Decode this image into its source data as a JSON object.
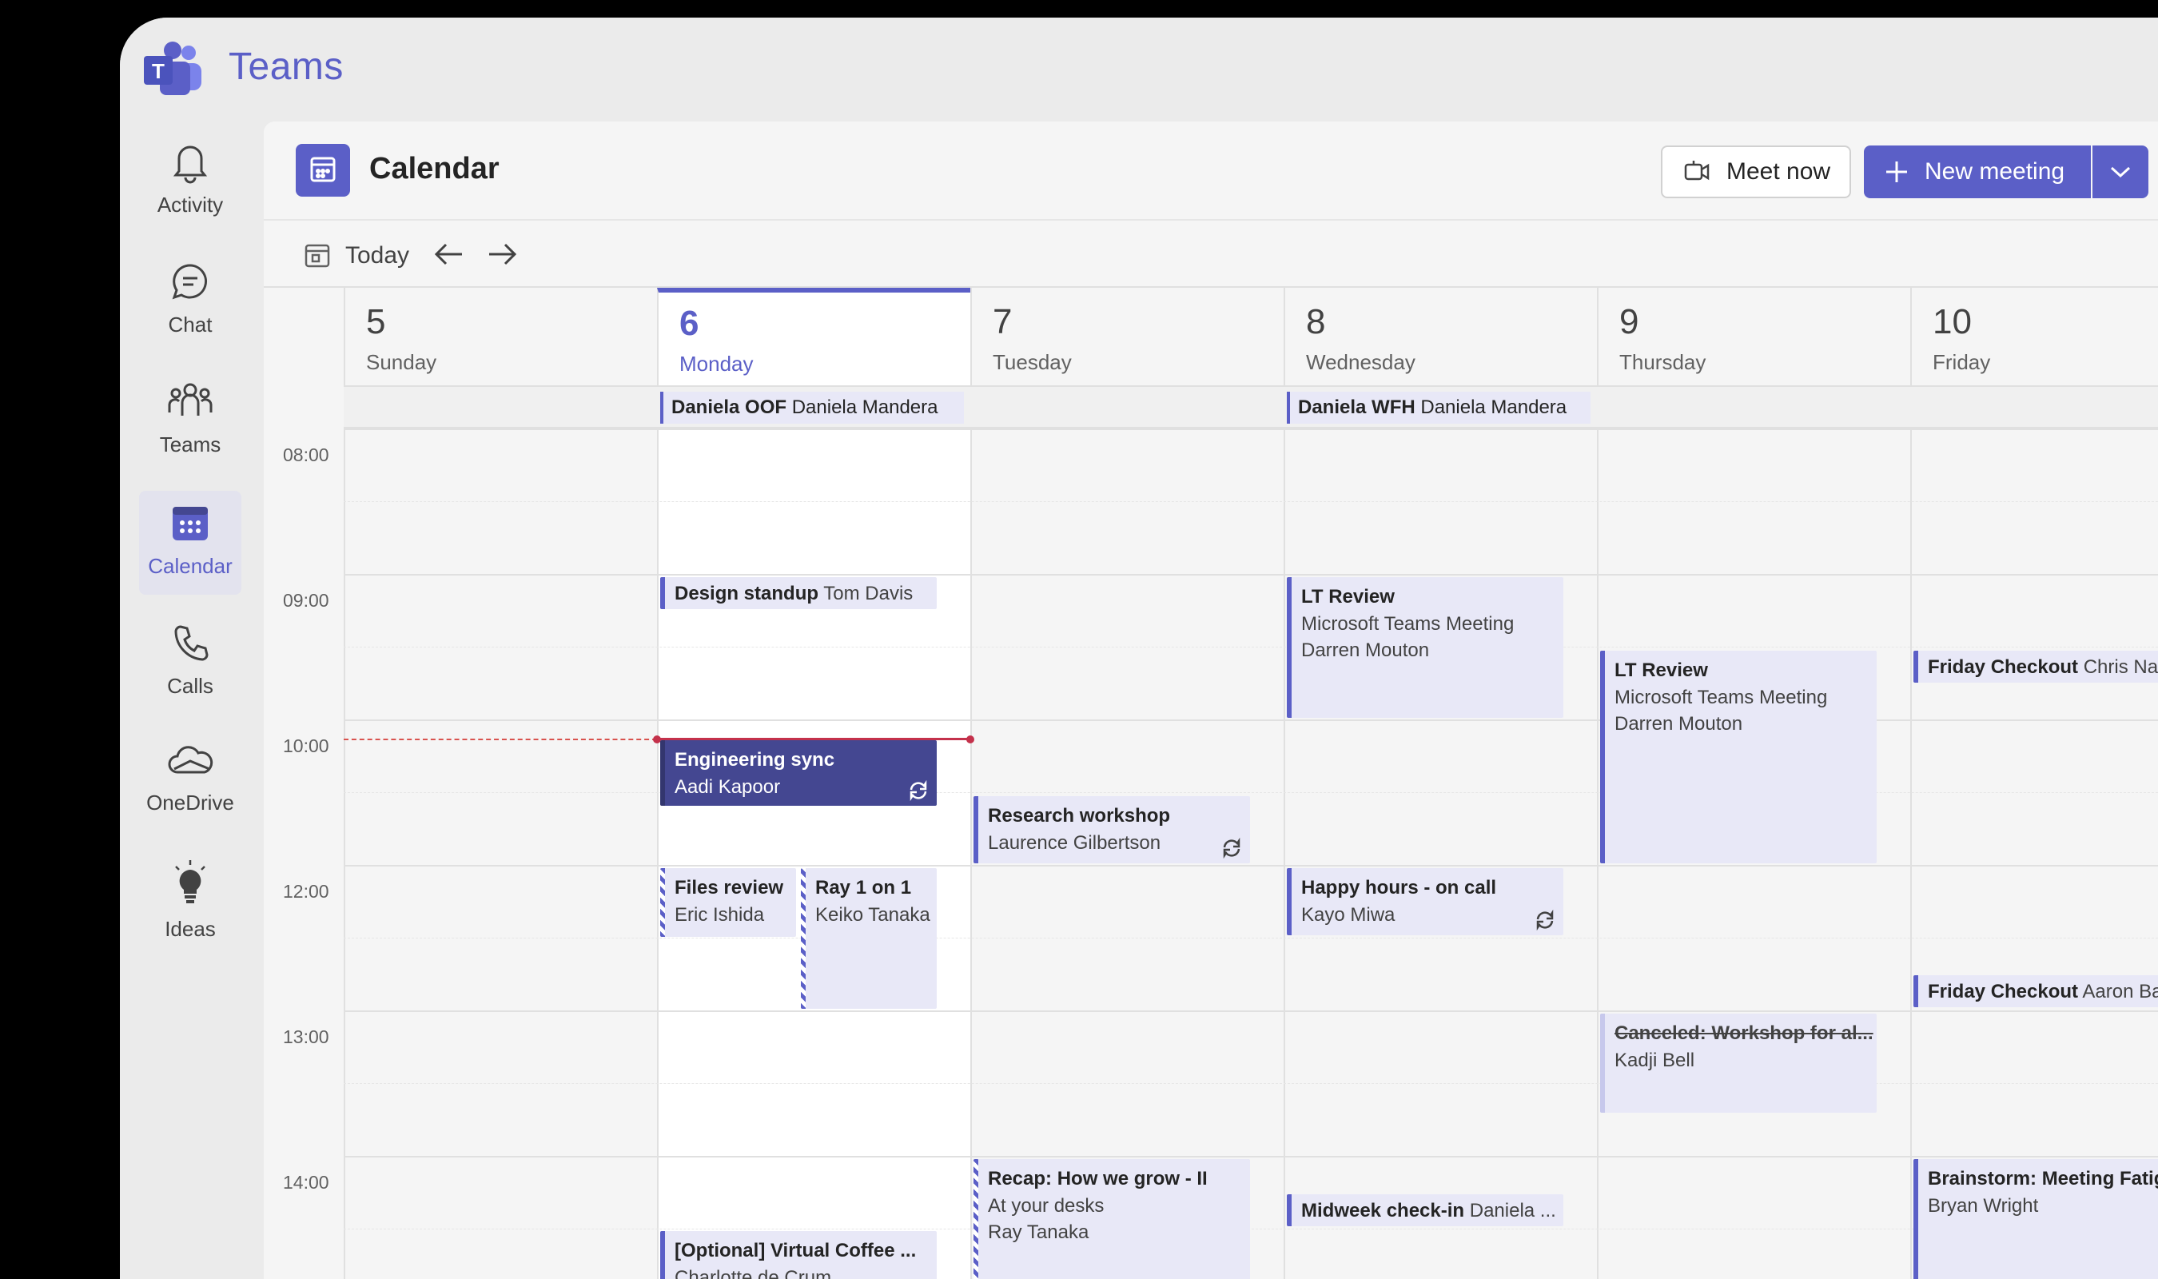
{
  "app": {
    "title": "Teams",
    "brand_color": "#5b5fc7"
  },
  "rail": [
    {
      "label": "Activity",
      "icon": "bell-icon"
    },
    {
      "label": "Chat",
      "icon": "chat-icon"
    },
    {
      "label": "Teams",
      "icon": "teams-icon"
    },
    {
      "label": "Calendar",
      "icon": "calendar-icon",
      "active": true
    },
    {
      "label": "Calls",
      "icon": "phone-icon"
    },
    {
      "label": "OneDrive",
      "icon": "cloud-icon"
    },
    {
      "label": "Ideas",
      "icon": "lightbulb-icon"
    }
  ],
  "header": {
    "title": "Calendar",
    "meet_now": "Meet now",
    "new_meeting": "New meeting"
  },
  "toolbar": {
    "today": "Today"
  },
  "days": [
    {
      "num": "5",
      "name": "Sunday"
    },
    {
      "num": "6",
      "name": "Monday",
      "today": true
    },
    {
      "num": "7",
      "name": "Tuesday"
    },
    {
      "num": "8",
      "name": "Wednesday"
    },
    {
      "num": "9",
      "name": "Thursday"
    },
    {
      "num": "10",
      "name": "Friday"
    }
  ],
  "times": [
    "08:00",
    "09:00",
    "10:00",
    "12:00",
    "13:00",
    "14:00"
  ],
  "allday": [
    {
      "title": "Daniela OOF",
      "person": "Daniela Mandera"
    },
    {
      "title": "Daniela WFH",
      "person": "Daniela Mandera"
    }
  ],
  "events": {
    "design_standup": {
      "title": "Design standup",
      "person": "Tom Davis"
    },
    "engineering_sync": {
      "title": "Engineering sync",
      "person": "Aadi Kapoor"
    },
    "files_review": {
      "title": "Files review",
      "person": "Eric Ishida"
    },
    "ray_1on1": {
      "title": "Ray 1 on 1",
      "person": "Keiko Tanaka"
    },
    "virtual_coffee": {
      "title": "[Optional] Virtual Coffee ...",
      "person": "Charlotte de Crum"
    },
    "research_workshop": {
      "title": "Research workshop",
      "person": "Laurence Gilbertson"
    },
    "recap": {
      "title": "Recap: How we grow - II",
      "line2": "At your desks",
      "person": "Ray Tanaka"
    },
    "lt_review_wed": {
      "title": "LT Review",
      "line2": "Microsoft Teams Meeting",
      "person": "Darren Mouton"
    },
    "happy_hours": {
      "title": "Happy hours - on call",
      "person": "Kayo Miwa"
    },
    "midweek": {
      "title": "Midweek check-in",
      "person": "Daniela ..."
    },
    "lt_review_thu": {
      "title": "LT Review",
      "line2": "Microsoft Teams Meeting",
      "person": "Darren Mouton"
    },
    "canceled_workshop": {
      "title": "Canceled: Workshop for al...",
      "person": "Kadji Bell"
    },
    "friday_checkout_1": {
      "title": "Friday Checkout",
      "person": "Chris Na"
    },
    "friday_checkout_2": {
      "title": "Friday Checkout",
      "person": "Aaron Ba"
    },
    "brainstorm": {
      "title": "Brainstorm: Meeting Fatig",
      "person": "Bryan Wright"
    }
  }
}
